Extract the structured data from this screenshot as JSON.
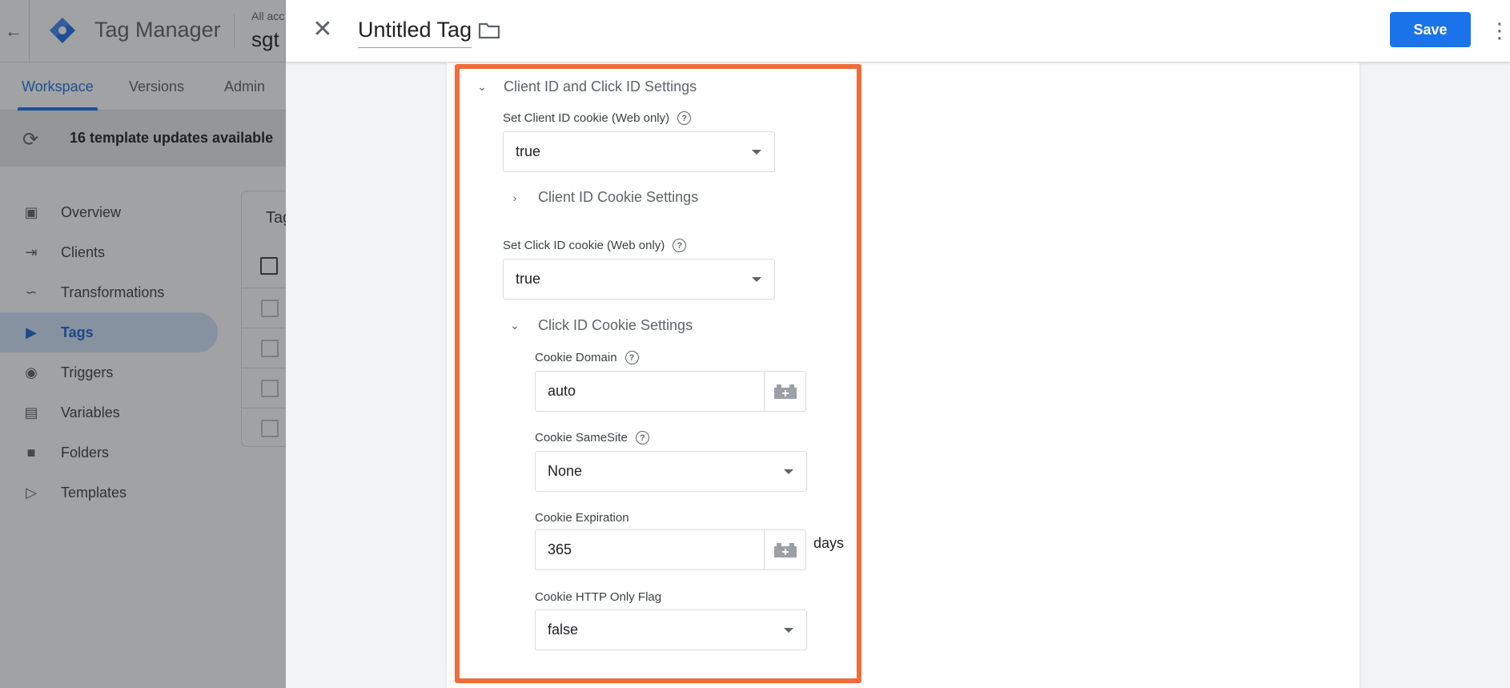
{
  "background": {
    "app_title": "Tag Manager",
    "account_small": "All acc",
    "account_big": "sgt",
    "tabs": [
      "Workspace",
      "Versions",
      "Admin"
    ],
    "banner_text": "16 template updates available",
    "nav": [
      {
        "label": "Overview",
        "icon": "overview-icon"
      },
      {
        "label": "Clients",
        "icon": "clients-icon"
      },
      {
        "label": "Transformations",
        "icon": "transformations-icon"
      },
      {
        "label": "Tags",
        "icon": "tag-icon",
        "active": true
      },
      {
        "label": "Triggers",
        "icon": "trigger-icon"
      },
      {
        "label": "Variables",
        "icon": "variables-icon"
      },
      {
        "label": "Folders",
        "icon": "folder-icon"
      },
      {
        "label": "Templates",
        "icon": "template-icon"
      }
    ],
    "card_title": "Tag"
  },
  "header": {
    "tag_name": "Untitled Tag",
    "save_label": "Save"
  },
  "colors": {
    "accent": "#1a73e8",
    "highlight": "#f26b3a"
  },
  "settings": {
    "section_title": "Client ID and Click ID Settings",
    "client_id_cookie_label": "Set Client ID cookie (Web only)",
    "client_id_cookie_value": "true",
    "client_id_cookie_settings": "Client ID Cookie Settings",
    "click_id_cookie_label": "Set Click ID cookie (Web only)",
    "click_id_cookie_value": "true",
    "click_id_cookie_settings": "Click ID Cookie Settings",
    "cookie_domain_label": "Cookie Domain",
    "cookie_domain_value": "auto",
    "cookie_samesite_label": "Cookie SameSite",
    "cookie_samesite_value": "None",
    "cookie_expiration_label": "Cookie Expiration",
    "cookie_expiration_value": "365",
    "cookie_expiration_suffix": "days",
    "cookie_http_only_label": "Cookie HTTP Only Flag",
    "cookie_http_only_value": "false"
  }
}
